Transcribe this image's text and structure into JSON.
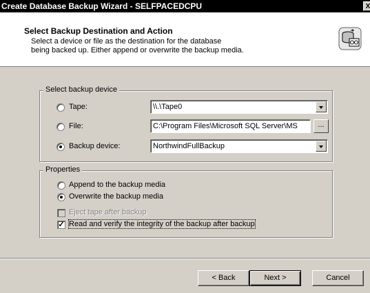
{
  "window": {
    "title": "Create Database Backup Wizard - SELFPACEDCPU",
    "close_glyph": "X"
  },
  "header": {
    "title": "Select Backup Destination and Action",
    "description_line1": "Select a device or file as the destination for the database",
    "description_line2": "being backed up. Either append or overwrite the backup media."
  },
  "device_group": {
    "legend": "Select backup device",
    "options": [
      {
        "label": "Tape:",
        "value": "\\\\.\\Tape0",
        "selected": false
      },
      {
        "label": "File:",
        "value": "C:\\Program Files\\Microsoft SQL Server\\MS",
        "selected": false
      },
      {
        "label": "Backup device:",
        "value": "NorthwindFullBackup",
        "selected": true
      }
    ],
    "browse_label": "..."
  },
  "properties_group": {
    "legend": "Properties",
    "append_label": "Append to the backup media",
    "overwrite_label": "Overwrite the backup media",
    "eject_label": "Eject tape after backup",
    "verify_label": "Read and verify the integrity of the backup after backup",
    "verify_checkmark": "✓"
  },
  "buttons": {
    "back": "< Back",
    "next": "Next >",
    "cancel": "Cancel"
  }
}
